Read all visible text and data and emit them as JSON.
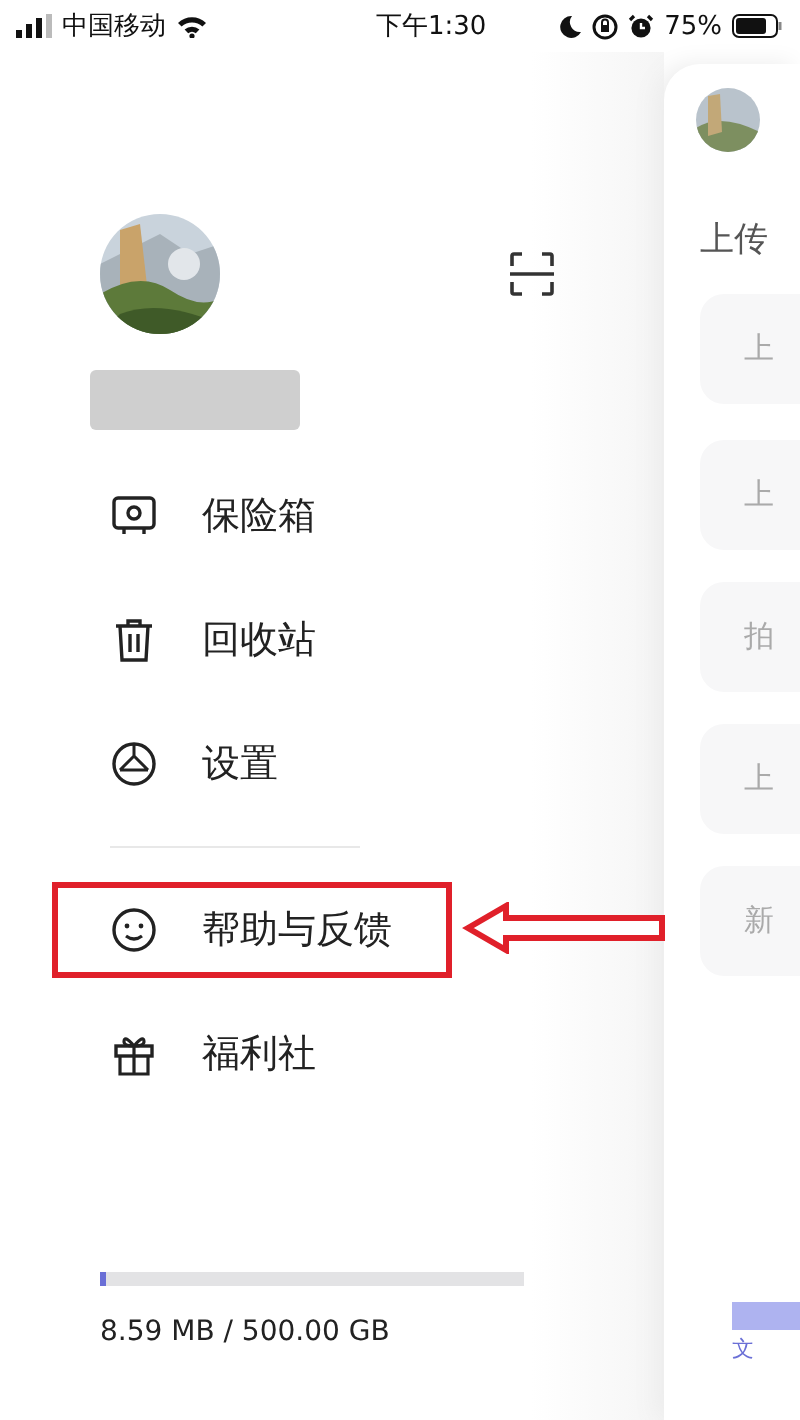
{
  "status_bar": {
    "carrier": "中国移动",
    "time": "下午1:30",
    "battery": "75%"
  },
  "drawer": {
    "menu": [
      {
        "kind": "safe",
        "label": "保险箱",
        "highlighted": false
      },
      {
        "kind": "trash",
        "label": "回收站",
        "highlighted": false
      },
      {
        "kind": "settings",
        "label": "设置",
        "highlighted": false
      },
      {
        "kind": "divider"
      },
      {
        "kind": "help",
        "label": "帮助与反馈",
        "highlighted": true
      },
      {
        "kind": "gift",
        "label": "福利社",
        "highlighted": false
      }
    ],
    "storage": {
      "level": 0.01,
      "reading": "8.59 MB / 500.00 GB"
    }
  },
  "main_panel": {
    "heading": "上传",
    "cards": [
      "上",
      "上",
      "拍",
      "上",
      "新"
    ],
    "tab_label": "文"
  }
}
